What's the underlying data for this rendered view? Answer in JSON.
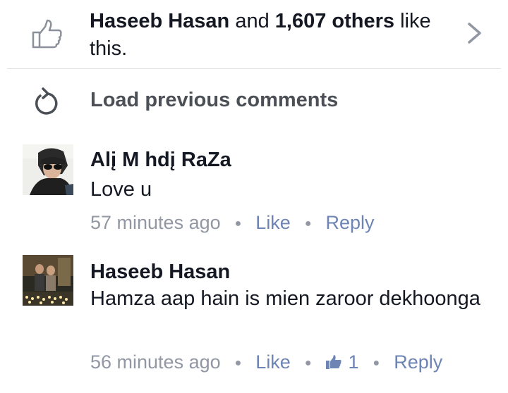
{
  "likes": {
    "name": "Haseeb Hasan",
    "connector": " and ",
    "others": "1,607 others",
    "tail": " like this.",
    "icon": "thumbs-up-icon",
    "chevron": "chevron-right-icon"
  },
  "load_previous": {
    "label": "Load previous comments",
    "icon": "refresh-icon"
  },
  "comments": [
    {
      "author": "Alį M hdį RaZa",
      "text": "Love u",
      "time": "57 minutes ago",
      "like_label": "Like",
      "reply_label": "Reply"
    },
    {
      "author": "Haseeb Hasan",
      "text": "Hamza aap hain is mien zaroor dekhoonga",
      "time": "56 minutes ago",
      "like_label": "Like",
      "like_count": "1",
      "reply_label": "Reply"
    }
  ],
  "colors": {
    "text": "#141823",
    "meta": "#9197a3",
    "link": "#6d84b4",
    "icon": "#8b909a"
  }
}
